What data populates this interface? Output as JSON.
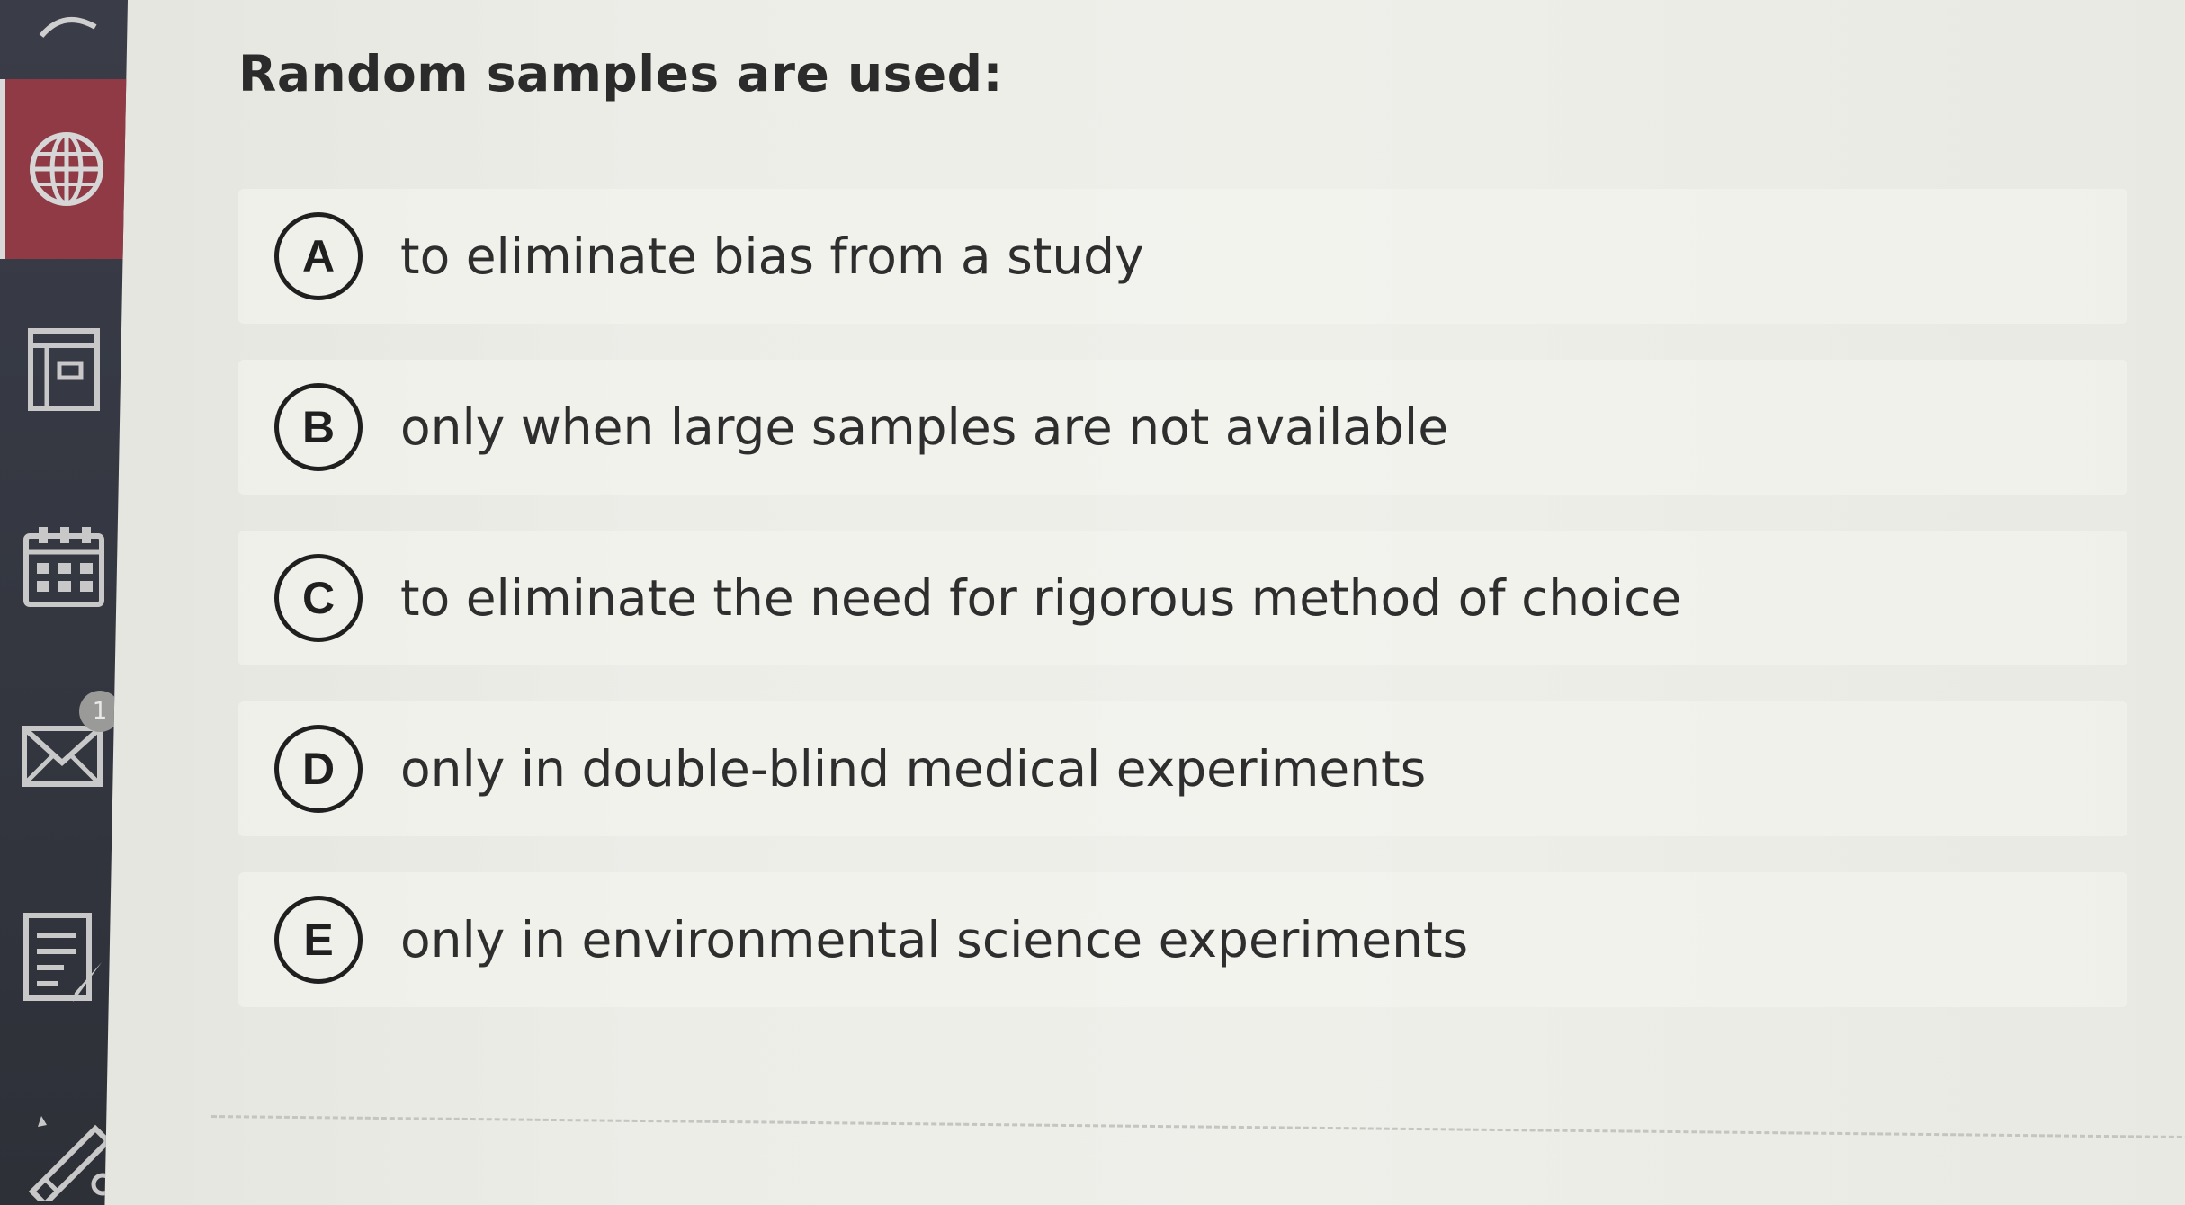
{
  "question": {
    "text": "Random samples are used:"
  },
  "choices": [
    {
      "letter": "A",
      "text": "to eliminate bias from a study"
    },
    {
      "letter": "B",
      "text": "only when large samples are not available"
    },
    {
      "letter": "C",
      "text": "to eliminate the need for rigorous method of choice"
    },
    {
      "letter": "D",
      "text": "only in double-blind medical experiments"
    },
    {
      "letter": "E",
      "text": "only in environmental science experiments"
    }
  ],
  "sidebar": {
    "items": [
      {
        "icon": "globe-icon",
        "active": true
      },
      {
        "icon": "window-icon"
      },
      {
        "icon": "calendar-icon"
      },
      {
        "icon": "mail-icon"
      },
      {
        "icon": "notes-icon"
      },
      {
        "icon": "pencil-icon"
      }
    ]
  },
  "colors": {
    "sidebar": "#35383f",
    "active": "#8f3a45",
    "background": "#ececE7",
    "text": "#2e2e2e"
  }
}
